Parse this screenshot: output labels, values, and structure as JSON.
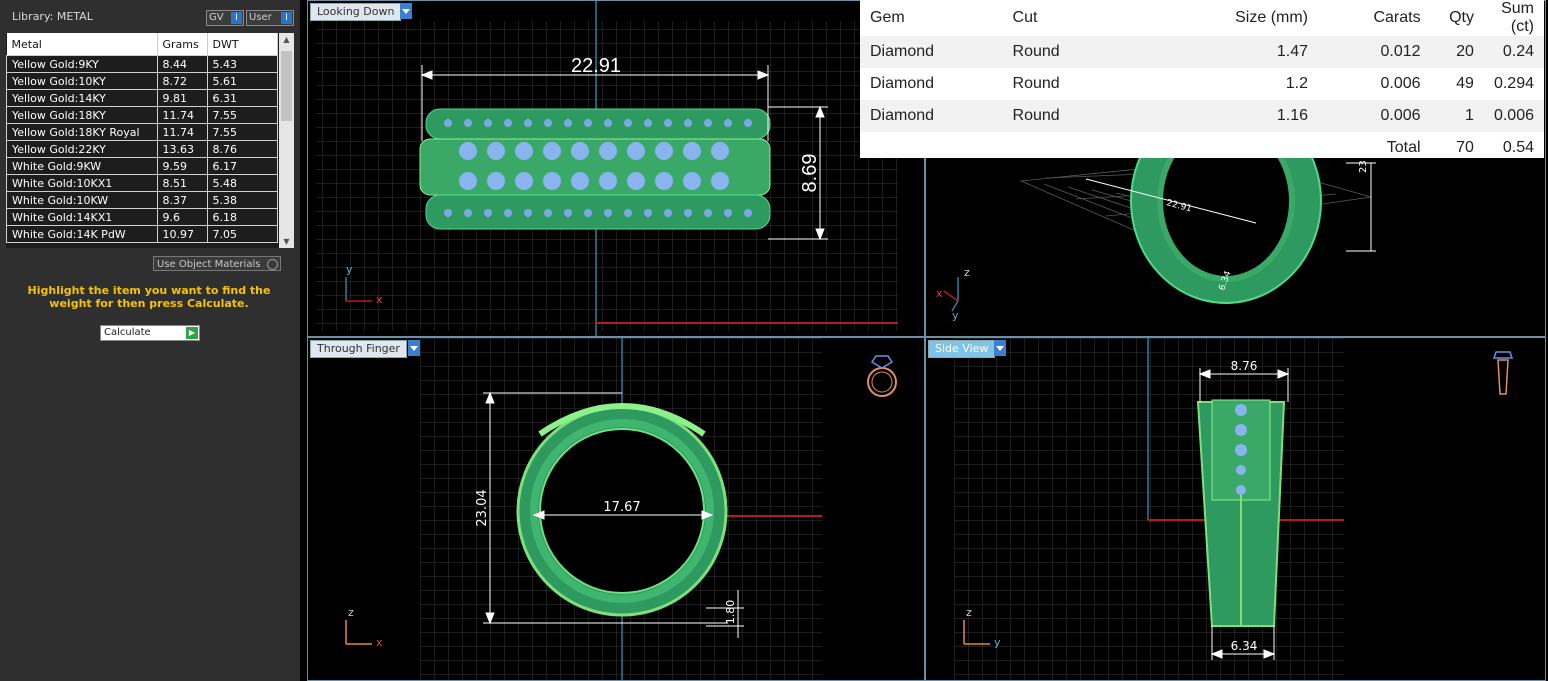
{
  "library": {
    "title": "Library: METAL",
    "gv_label": "GV",
    "user_label": "User",
    "toggle_mark": "I",
    "columns": [
      "Metal",
      "Grams",
      "DWT"
    ],
    "rows": [
      {
        "metal": "Yellow Gold:9KY",
        "grams": "8.44",
        "dwt": "5.43"
      },
      {
        "metal": "Yellow Gold:10KY",
        "grams": "8.72",
        "dwt": "5.61"
      },
      {
        "metal": "Yellow Gold:14KY",
        "grams": "9.81",
        "dwt": "6.31"
      },
      {
        "metal": "Yellow Gold:18KY",
        "grams": "11.74",
        "dwt": "7.55"
      },
      {
        "metal": "Yellow Gold:18KY Royal",
        "grams": "11.74",
        "dwt": "7.55"
      },
      {
        "metal": "Yellow Gold:22KY",
        "grams": "13.63",
        "dwt": "8.76"
      },
      {
        "metal": "White Gold:9KW",
        "grams": "9.59",
        "dwt": "6.17"
      },
      {
        "metal": "White Gold:10KX1",
        "grams": "8.51",
        "dwt": "5.48"
      },
      {
        "metal": "White Gold:10KW",
        "grams": "8.37",
        "dwt": "5.38"
      },
      {
        "metal": "White Gold:14KX1",
        "grams": "9.6",
        "dwt": "6.18"
      },
      {
        "metal": "White Gold:14K PdW",
        "grams": "10.97",
        "dwt": "7.05"
      }
    ],
    "use_object_materials": "Use Object Materials",
    "hint": "Highlight the item you want to find the weight for then press Calculate.",
    "calculate_label": "Calculate"
  },
  "viewports": {
    "top_left": {
      "label": "Looking Down",
      "dim_width": "22.91",
      "dim_height": "8.69",
      "axis_y": "y",
      "axis_x": "x"
    },
    "top_right": {
      "dim_a": "23",
      "dim_b": "6.34",
      "dim_c": "22.91",
      "axis_z": "z",
      "axis_x": "x",
      "axis_y": "y"
    },
    "bottom_left": {
      "label": "Through Finger",
      "dim_outer": "23.04",
      "dim_inner": "17.67",
      "dim_thick": "1.80",
      "axis_z": "z",
      "axis_x": "x"
    },
    "bottom_right": {
      "label": "Side View",
      "dim_top": "8.76",
      "dim_bottom": "6.34",
      "axis_z": "z",
      "axis_y": "y"
    }
  },
  "gem_table": {
    "headers": [
      "Gem",
      "Cut",
      "Size (mm)",
      "Carats",
      "Qty",
      "Sum (ct)"
    ],
    "rows": [
      {
        "gem": "Diamond",
        "cut": "Round",
        "size": "1.47",
        "carats": "0.012",
        "qty": "20",
        "sum": "0.24"
      },
      {
        "gem": "Diamond",
        "cut": "Round",
        "size": "1.2",
        "carats": "0.006",
        "qty": "49",
        "sum": "0.294"
      },
      {
        "gem": "Diamond",
        "cut": "Round",
        "size": "1.16",
        "carats": "0.006",
        "qty": "1",
        "sum": "0.006"
      }
    ],
    "total_label": "Total",
    "total_qty": "70",
    "total_sum": "0.54"
  },
  "colors": {
    "metal": "#2f9a60",
    "metal_light": "#7ee07a",
    "gem": "#8ab4f0",
    "grid": "#3c3c3c",
    "axis_blue": "#2a7fa0",
    "axis_red": "#b21d1d",
    "accent_yellow": "#f5c400"
  },
  "icons": [
    "ring-front-icon",
    "ring-side-icon",
    "dropdown-arrow-icon",
    "calculate-go-icon"
  ]
}
